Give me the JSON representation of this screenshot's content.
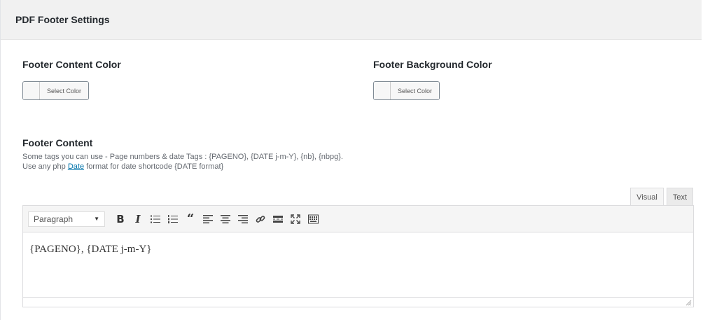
{
  "panel": {
    "title": "PDF Footer Settings"
  },
  "footer_content_color": {
    "label": "Footer Content Color",
    "button_label": "Select Color"
  },
  "footer_background_color": {
    "label": "Footer Background Color",
    "button_label": "Select Color"
  },
  "footer_content": {
    "label": "Footer Content",
    "description_line1": "Some tags you can use - Page numbers & date Tags : {PAGENO}, {DATE j-m-Y}, {nb}, {nbpg}.",
    "description_line2_prefix": "Use any php ",
    "description_link": "Date",
    "description_line2_suffix": " format for date shortcode {DATE format}"
  },
  "editor": {
    "tabs": {
      "visual": "Visual",
      "text": "Text"
    },
    "format_select": "Paragraph",
    "toolbar_icons": [
      "bold-icon",
      "italic-icon",
      "bullet-list-icon",
      "numbered-list-icon",
      "blockquote-icon",
      "align-left-icon",
      "align-center-icon",
      "align-right-icon",
      "link-icon",
      "read-more-icon",
      "fullscreen-icon",
      "toolbar-toggle-icon"
    ],
    "content": "{PAGENO}, {DATE j-m-Y}"
  }
}
